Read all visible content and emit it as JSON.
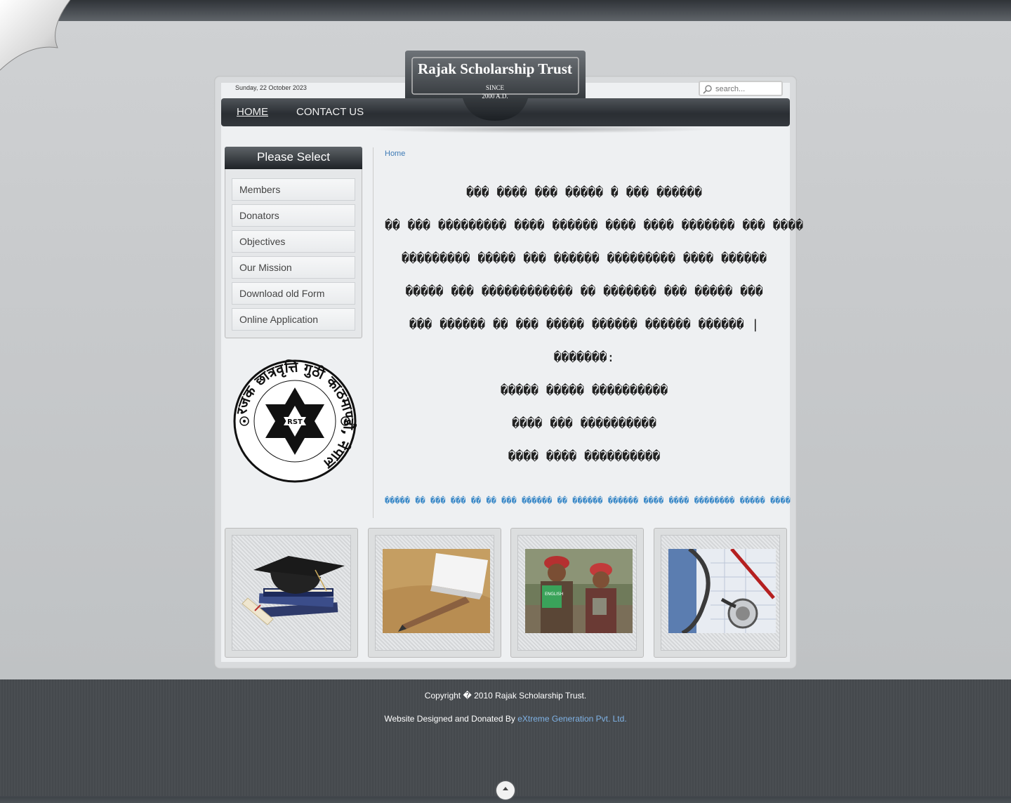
{
  "header": {
    "date": "Sunday, 22 October 2023",
    "search_placeholder": "search...",
    "logo_title": "Rajak Scholarship Trust",
    "logo_since": "SINCE",
    "logo_year": "2000 A.D."
  },
  "nav": {
    "home": "HOME",
    "contact": "CONTACT US"
  },
  "sidebar": {
    "title": "Please Select",
    "items": [
      "Members",
      "Donators",
      "Objectives",
      "Our Mission",
      "Download old Form",
      "Online Application"
    ],
    "emblem_text": "रजक छात्रवृत्ति गुठी काठमाण्डौ, नेपाल",
    "emblem_center": "RST"
  },
  "main": {
    "breadcrumb": "Home",
    "lines": [
      "��� ���� ��� ����� � ��� ������",
      "�� ��� ��������� ���� ������ ���� ���� ������� ��� ����",
      "��������� ����� ��� ������ ��������� ���� ������",
      "����� ��� ������������ �� ������� ��� ����� ���",
      "��� ������ �� ��� ����� ������ ������ ������ |",
      "�������:",
      "����� ����� ����������",
      "���� ��� ����������",
      "���� ���� ����������"
    ],
    "link_line": "����� �� ��� ��� �� �� ��� ������ �� ������ ������ ���� ���� �������� ����� ����"
  },
  "thumbs": [
    "graduation-cap-books-image",
    "pencil-eraser-image",
    "children-with-books-image",
    "stethoscope-image"
  ],
  "footer": {
    "copyright": "Copyright � 2010 Rajak Scholarship Trust.",
    "designed_prefix": "Website Designed and Donated By ",
    "designed_link": "eXtreme Generation Pvt. Ltd."
  },
  "colors": {
    "accent_link": "#3d7ab5",
    "nav_bg": "#2a2e33",
    "footer_bg": "#4a4e52"
  }
}
